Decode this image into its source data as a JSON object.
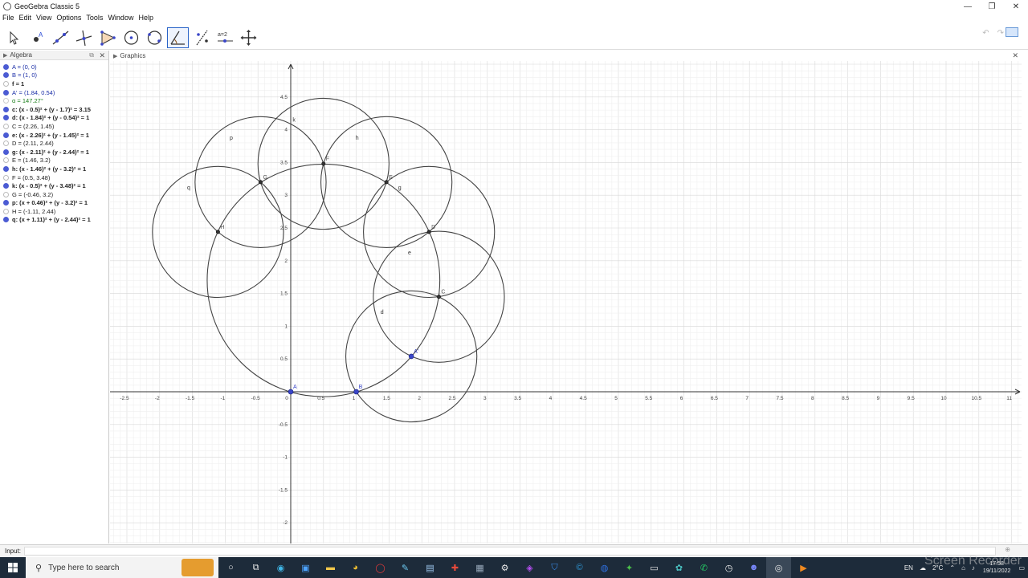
{
  "window": {
    "title": "GeoGebra Classic 5",
    "controls": [
      "—",
      "❐",
      "✕"
    ]
  },
  "menu": [
    "File",
    "Edit",
    "View",
    "Options",
    "Tools",
    "Window",
    "Help"
  ],
  "toolbar": {
    "tools": [
      "move-tool",
      "point-tool",
      "line-tool",
      "perpendicular-tool",
      "polygon-tool",
      "circle-center-tool",
      "circle-three-points-tool",
      "angle-tool",
      "reflect-tool",
      "slider-tool",
      "move-graphics-tool"
    ],
    "active_index": 7,
    "slider_label": "a=2",
    "undo": "↶",
    "redo": "↷"
  },
  "algebra": {
    "title": "Algebra",
    "rows": [
      {
        "text": "A = (0, 0)",
        "kind": "point",
        "style": "blue"
      },
      {
        "text": "B = (1, 0)",
        "kind": "point",
        "style": "blue"
      },
      {
        "text": "f = 1",
        "kind": "hidden-obj",
        "style": "bold"
      },
      {
        "text": "A' = (1.84, 0.54)",
        "kind": "point",
        "style": "blue"
      },
      {
        "text": "α = 147.27°",
        "kind": "num",
        "style": "green"
      },
      {
        "text": "c: (x - 0.5)² + (y - 1.7)² = 3.15",
        "kind": "conic",
        "style": "bold"
      },
      {
        "text": "d: (x - 1.84)² + (y - 0.54)² = 1",
        "kind": "conic",
        "style": "bold"
      },
      {
        "text": "C = (2.26, 1.45)",
        "kind": "hidden-obj",
        "style": ""
      },
      {
        "text": "e: (x - 2.26)² + (y - 1.45)² = 1",
        "kind": "conic",
        "style": "bold"
      },
      {
        "text": "D = (2.11, 2.44)",
        "kind": "hidden-obj",
        "style": ""
      },
      {
        "text": "g: (x - 2.11)² + (y - 2.44)² = 1",
        "kind": "conic",
        "style": "bold"
      },
      {
        "text": "E = (1.46, 3.2)",
        "kind": "hidden-obj",
        "style": ""
      },
      {
        "text": "h: (x - 1.46)² + (y - 3.2)² = 1",
        "kind": "conic",
        "style": "bold"
      },
      {
        "text": "F = (0.5, 3.48)",
        "kind": "hidden-obj",
        "style": ""
      },
      {
        "text": "k: (x - 0.5)² + (y - 3.48)² = 1",
        "kind": "conic",
        "style": "bold"
      },
      {
        "text": "G = (-0.46, 3.2)",
        "kind": "hidden-obj",
        "style": ""
      },
      {
        "text": "p: (x + 0.46)² + (y - 3.2)² = 1",
        "kind": "conic",
        "style": "bold"
      },
      {
        "text": "H = (-1.11, 2.44)",
        "kind": "hidden-obj",
        "style": ""
      },
      {
        "text": "q: (x + 1.11)² + (y - 2.44)² = 1",
        "kind": "conic",
        "style": "bold"
      }
    ]
  },
  "graphics": {
    "title": "Graphics",
    "x_range": [
      -2.5,
      11
    ],
    "y_range": [
      -2,
      4.5
    ],
    "x_ticks": [
      "-2.5",
      "-2",
      "-1.5",
      "-1",
      "-0.5",
      "0",
      "0.5",
      "1",
      "1.5",
      "2",
      "2.5",
      "3",
      "3.5",
      "4",
      "4.5",
      "5",
      "5.5",
      "6",
      "6.5",
      "7",
      "7.5",
      "8",
      "8.5",
      "9",
      "9.5",
      "10",
      "10.5",
      "11"
    ],
    "y_ticks": [
      "-2",
      "-1.5",
      "-1",
      "-0.5",
      "0.5",
      "1",
      "1.5",
      "2",
      "2.5",
      "3",
      "3.5",
      "4",
      "4.5"
    ],
    "circle_color": "#444444",
    "point_color": "#3a46c8",
    "circles": [
      {
        "name": "c",
        "cx": 0.5,
        "cy": 1.7,
        "r": 1.775,
        "label": ""
      },
      {
        "name": "d",
        "cx": 1.84,
        "cy": 0.54,
        "r": 1,
        "label": "d"
      },
      {
        "name": "e",
        "cx": 2.26,
        "cy": 1.45,
        "r": 1,
        "label": "e"
      },
      {
        "name": "g",
        "cx": 2.11,
        "cy": 2.44,
        "r": 1,
        "label": "g"
      },
      {
        "name": "h",
        "cx": 1.46,
        "cy": 3.2,
        "r": 1,
        "label": "h"
      },
      {
        "name": "k",
        "cx": 0.5,
        "cy": 3.48,
        "r": 1,
        "label": "k"
      },
      {
        "name": "p",
        "cx": -0.46,
        "cy": 3.2,
        "r": 1,
        "label": "p"
      },
      {
        "name": "q",
        "cx": -1.11,
        "cy": 2.44,
        "r": 1,
        "label": "q"
      }
    ],
    "points": [
      {
        "name": "A",
        "x": 0,
        "y": 0,
        "free": true
      },
      {
        "name": "B",
        "x": 1,
        "y": 0,
        "free": true
      },
      {
        "name": "A'",
        "x": 1.84,
        "y": 0.54,
        "free": true
      },
      {
        "name": "C",
        "x": 2.26,
        "y": 1.45,
        "free": false
      },
      {
        "name": "D",
        "x": 2.11,
        "y": 2.44,
        "free": false
      },
      {
        "name": "E",
        "x": 1.46,
        "y": 3.2,
        "free": false
      },
      {
        "name": "F",
        "x": 0.5,
        "y": 3.48,
        "free": false
      },
      {
        "name": "G",
        "x": -0.46,
        "y": 3.2,
        "free": false
      },
      {
        "name": "H",
        "x": -1.11,
        "y": 2.44,
        "free": false
      }
    ]
  },
  "input_bar": {
    "label": "Input:"
  },
  "taskbar": {
    "search_placeholder": "Type here to search",
    "weather": "2°C",
    "language": "EN",
    "time": "17:58",
    "date": "19/11/2022"
  },
  "watermark": "Screen Recorder"
}
